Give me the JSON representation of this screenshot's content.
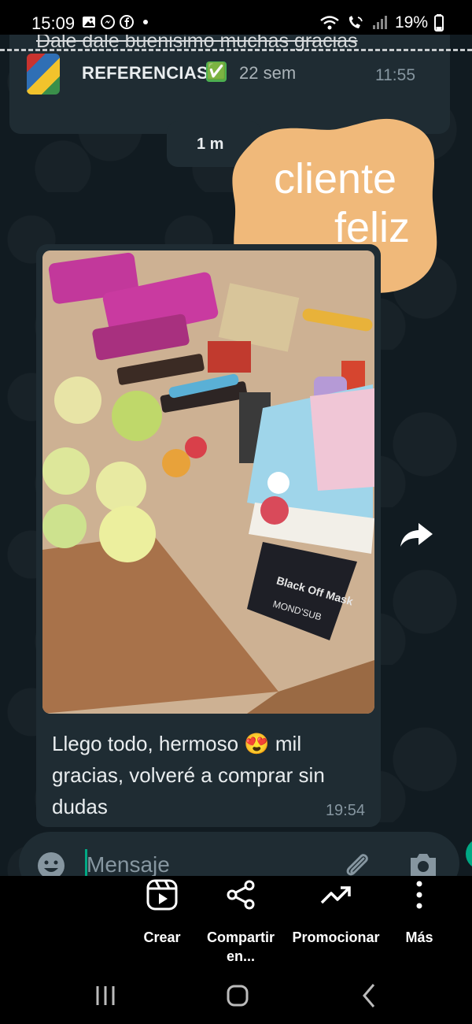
{
  "status_bar": {
    "time": "15:09",
    "battery": "19%",
    "left_icons": [
      "gallery-icon",
      "messenger-icon",
      "facebook-icon",
      "dot-icon"
    ],
    "right_icons": [
      "wifi-icon",
      "volte-call-icon",
      "signal-icon",
      "battery-icon"
    ]
  },
  "story": {
    "quoted_text": "Dale dale buenisimo muchas gracias",
    "reference": {
      "name": "REFERENCIAS",
      "check": "✅",
      "age": "22 sem",
      "time": "11:55"
    },
    "date_pill": "1 m",
    "sticker": {
      "line1": "cliente",
      "line2": "feliz",
      "color": "#f0b97a"
    },
    "message": {
      "text_before_emoji": "Llego todo, hermoso ",
      "emoji": "😍",
      "text_after_emoji": " mil gracias,  volveré a comprar sin dudas",
      "time": "19:54",
      "photo_texts": {
        "mask": "Black Off Mask",
        "mask_brand": "MOND'SUB"
      }
    },
    "compose": {
      "placeholder": "Mensaje"
    }
  },
  "actions": [
    {
      "label": "Crear",
      "icon": "reels-icon"
    },
    {
      "label": "Compartir en...",
      "icon": "share-icon"
    },
    {
      "label": "Promocionar",
      "icon": "trending-up-icon"
    },
    {
      "label": "Más",
      "icon": "more-vertical-icon"
    }
  ],
  "nav": [
    "recents-icon",
    "home-icon",
    "back-icon"
  ],
  "colors": {
    "bubble": "#1f2c33",
    "chat_bg": "#111b21",
    "accent": "#00a884",
    "sticker": "#f0b97a"
  }
}
